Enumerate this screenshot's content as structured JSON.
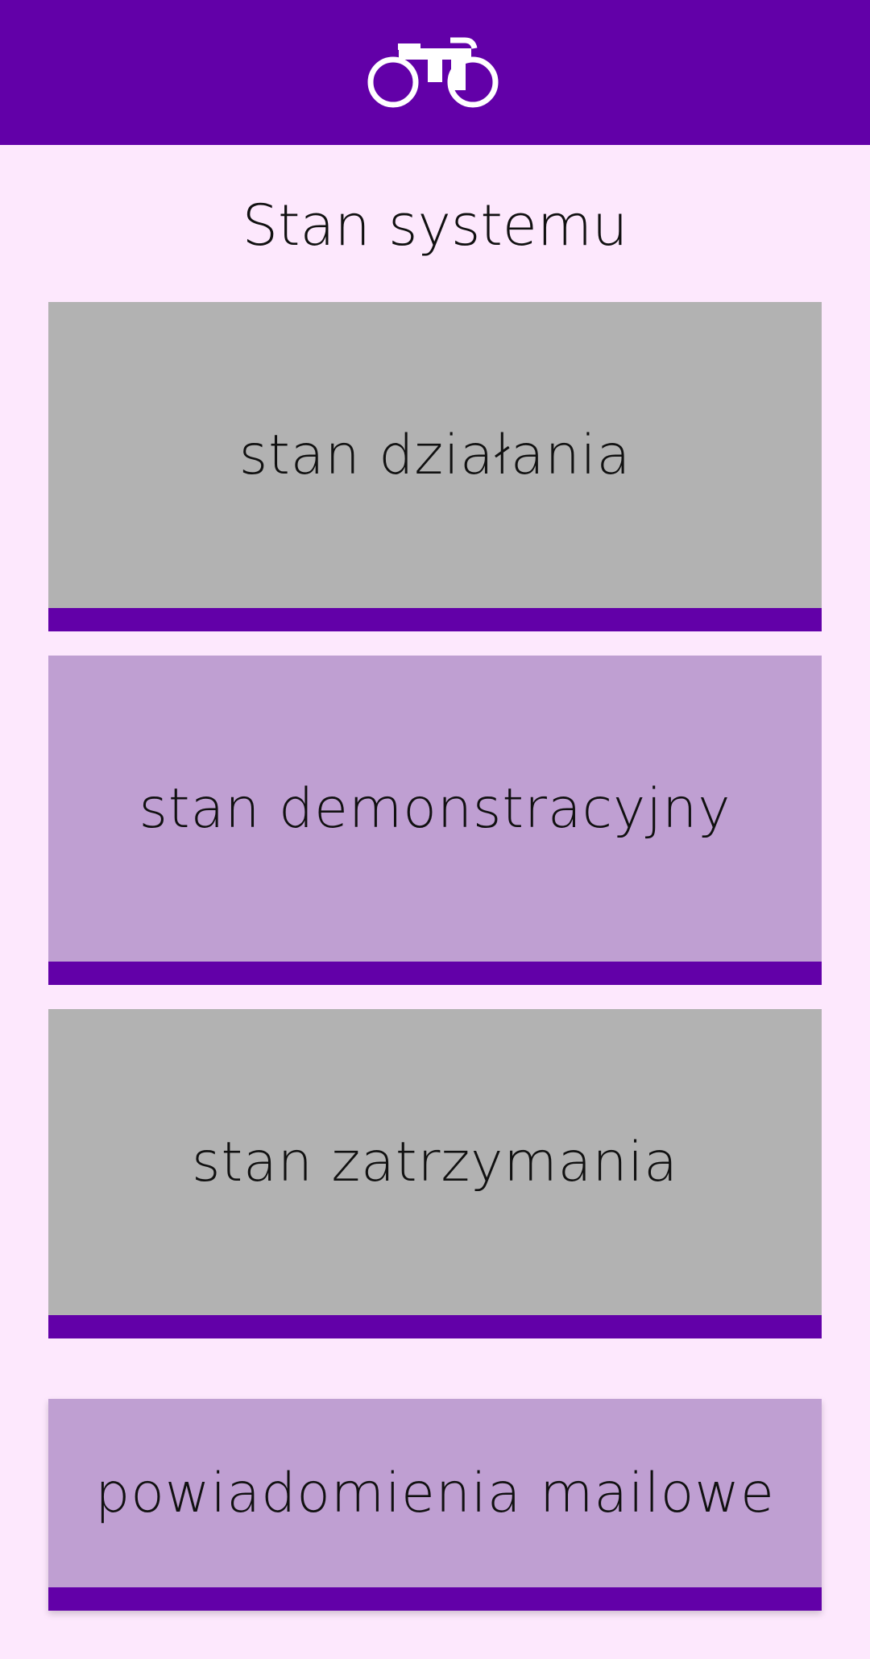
{
  "header": {
    "icon": "bicycle-icon",
    "background": "#6200a8"
  },
  "page": {
    "title": "Stan systemu"
  },
  "states": [
    {
      "label": "stan działania",
      "color": "#b2b2b2"
    },
    {
      "label": "stan demonstracyjny",
      "color": "#bf9fd2"
    },
    {
      "label": "stan zatrzymania",
      "color": "#b2b2b2"
    }
  ],
  "notifications": {
    "label": "powiadomienia mailowe",
    "color": "#bf9fd2"
  },
  "colors": {
    "accent": "#6200a8",
    "page_background": "#fde8fd"
  }
}
